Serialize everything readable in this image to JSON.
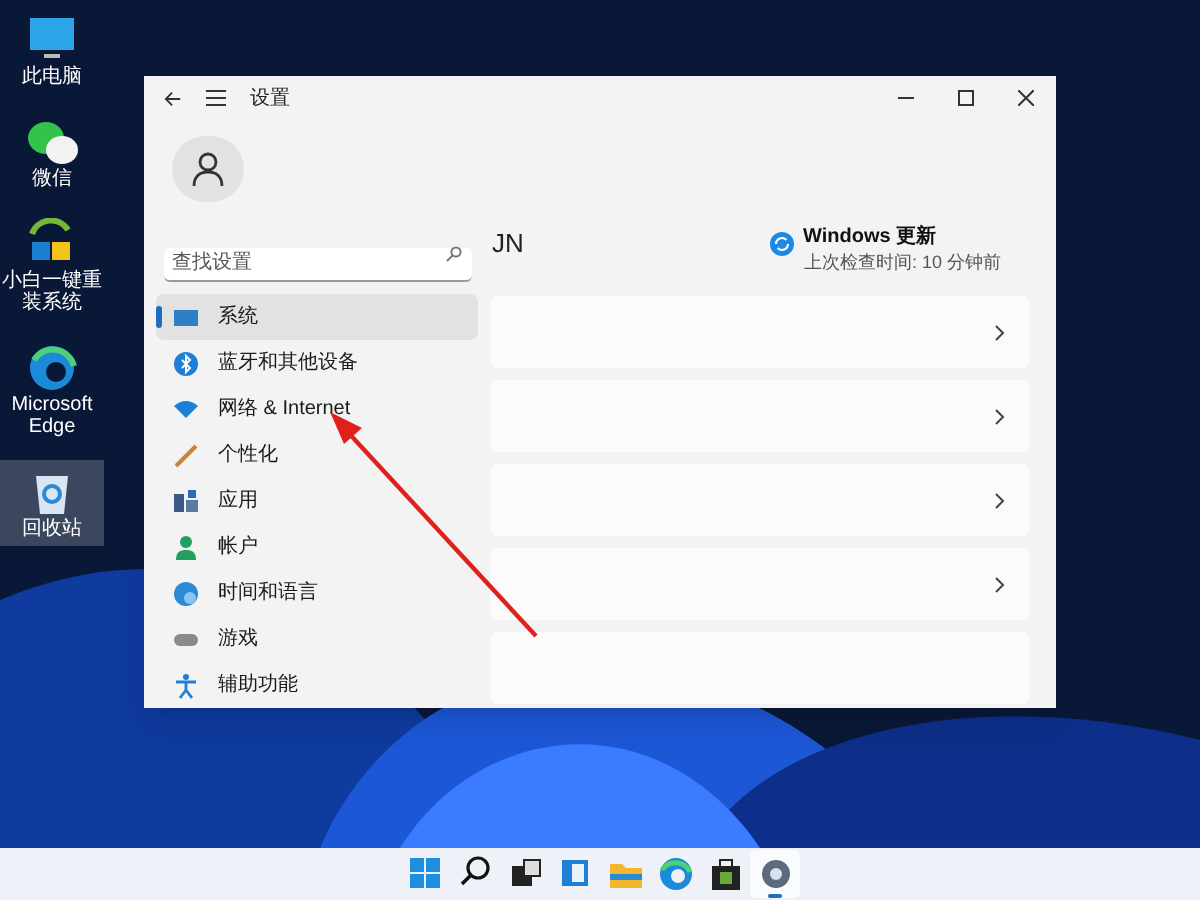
{
  "desktop_icons": [
    {
      "label": "此电脑",
      "kind": "pc",
      "selected": false
    },
    {
      "label": "微信",
      "kind": "chat",
      "selected": false
    },
    {
      "label": "小白一键重装系统",
      "kind": "installer",
      "selected": false
    },
    {
      "label": "Microsoft Edge",
      "kind": "edge",
      "selected": false
    },
    {
      "label": "回收站",
      "kind": "recycle",
      "selected": true
    }
  ],
  "window": {
    "title": "设置",
    "search": {
      "placeholder": "查找设置"
    },
    "nav_items": [
      {
        "label": "系统",
        "kind": "system",
        "selected": true
      },
      {
        "label": "蓝牙和其他设备",
        "kind": "bluetooth",
        "selected": false
      },
      {
        "label": "网络 & Internet",
        "kind": "network",
        "selected": false
      },
      {
        "label": "个性化",
        "kind": "personalize",
        "selected": false
      },
      {
        "label": "应用",
        "kind": "apps",
        "selected": false
      },
      {
        "label": "帐户",
        "kind": "account",
        "selected": false
      },
      {
        "label": "时间和语言",
        "kind": "time",
        "selected": false
      },
      {
        "label": "游戏",
        "kind": "gaming",
        "selected": false
      },
      {
        "label": "辅助功能",
        "kind": "accessibility",
        "selected": false
      }
    ],
    "account_name": "JN",
    "update": {
      "title": "Windows 更新",
      "subtitle": "上次检查时间: 10 分钟前"
    },
    "cards": [
      {
        "kind": "link"
      },
      {
        "kind": "link"
      },
      {
        "kind": "link"
      },
      {
        "kind": "link"
      },
      {
        "kind": "cut"
      }
    ]
  },
  "taskbar": [
    {
      "kind": "start",
      "active": false
    },
    {
      "kind": "search",
      "active": false
    },
    {
      "kind": "taskview",
      "active": false
    },
    {
      "kind": "widgets",
      "active": false
    },
    {
      "kind": "explorer",
      "active": false
    },
    {
      "kind": "edge",
      "active": false
    },
    {
      "kind": "store",
      "active": false
    },
    {
      "kind": "settings",
      "active": true
    }
  ]
}
